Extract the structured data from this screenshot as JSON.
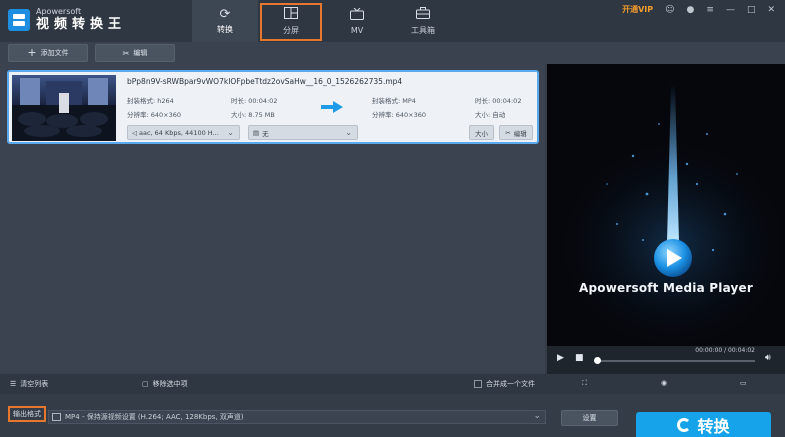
{
  "app": {
    "brand": "Apowersoft",
    "name": "视频转换王"
  },
  "tabs": [
    {
      "label": "转换",
      "icon": "refresh-icon"
    },
    {
      "label": "分屏",
      "icon": "split-screen-icon"
    },
    {
      "label": "MV",
      "icon": "tv-icon"
    },
    {
      "label": "工具箱",
      "icon": "toolbox-icon"
    }
  ],
  "topright": {
    "vip": "开通VIP"
  },
  "toolbar": {
    "add_file": "添加文件",
    "edit": "编辑"
  },
  "file": {
    "name": "bPp8n9V-sRWBpar9vWO7kIOFpbeTtdz2ovSaHw__16_0_1526262735.mp4",
    "src_format_label": "封装格式: h264",
    "src_duration_label": "时长: 00:04:02",
    "src_resolution_label": "分辨率: 640×360",
    "src_size_label": "大小: 8.75 MB",
    "dst_format_label": "封装格式: MP4",
    "dst_duration_label": "时长: 00:04:02",
    "dst_resolution_label": "分辨率: 640×360",
    "dst_size_label": "大小: 自动",
    "audio_track": "aac, 64 Kbps, 44100 H...",
    "subtitle": "无",
    "size_btn": "大小",
    "edit_btn": "编辑"
  },
  "player": {
    "title": "Apowersoft Media Player",
    "time": "00:00:00 / 00:04:02"
  },
  "bottom": {
    "clear_list": "清空列表",
    "remove_selected": "移除选中项",
    "merge": "合并成一个文件"
  },
  "footer": {
    "output_label": "输出格式",
    "format_value": "MP4 - 保持源视频设置 (H.264; AAC, 128Kbps, 双声道)",
    "settings": "设置",
    "convert": "转换"
  },
  "colors": {
    "accent": "#16a3ea",
    "highlight": "#e8772e",
    "vip": "#f39b2b"
  }
}
